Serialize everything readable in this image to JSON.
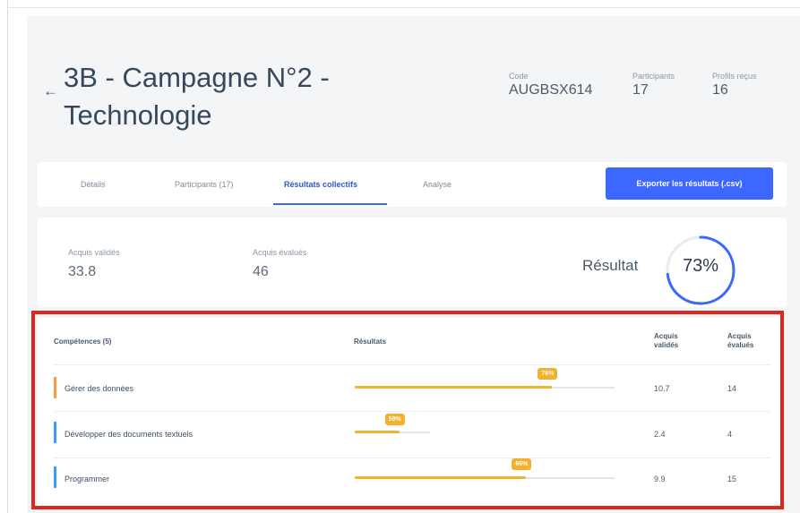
{
  "header": {
    "back_icon": "arrow-left-icon",
    "title": "3B - Campagne N°2 - Technologie",
    "code_label": "Code",
    "code_value": "AUGBSX614",
    "participants_label": "Participants",
    "participants_value": "17",
    "profiles_label": "Profils reçus",
    "profiles_value": "16"
  },
  "tabs": [
    {
      "label": "Détails",
      "active": false
    },
    {
      "label": "Participants (17)",
      "active": false
    },
    {
      "label": "Résultats collectifs",
      "active": true
    },
    {
      "label": "Analyse",
      "active": false
    }
  ],
  "export_label": "Exporter les résultats (.csv)",
  "stats": {
    "validated_label": "Acquis validés",
    "validated_value": "33.8",
    "evaluated_label": "Acquis évalués",
    "evaluated_value": "46",
    "result_label": "Résultat",
    "result_value": "73%",
    "result_fraction": 0.73
  },
  "table": {
    "headers": {
      "competences": "Compétences (5)",
      "results": "Résultats",
      "validated": "Acquis validés",
      "evaluated": "Acquis évalués"
    },
    "rows": [
      {
        "name": "Gérer des données",
        "percent_label": "76%",
        "percent": 0.76,
        "track": 1.0,
        "validated": "10.7",
        "evaluated": "14",
        "accent": "#f39c40"
      },
      {
        "name": "Développer des documents textuels",
        "percent_label": "59%",
        "percent": 0.59,
        "track": 0.29,
        "validated": "2.4",
        "evaluated": "4",
        "accent": "#3d9df3"
      },
      {
        "name": "Programmer",
        "percent_label": "66%",
        "percent": 0.66,
        "track": 1.0,
        "validated": "9.9",
        "evaluated": "15",
        "accent": "#3d9df3"
      }
    ]
  },
  "colors": {
    "primary": "#3d68ff",
    "bar": "#f2b12f",
    "highlight_frame": "#e0271b"
  }
}
